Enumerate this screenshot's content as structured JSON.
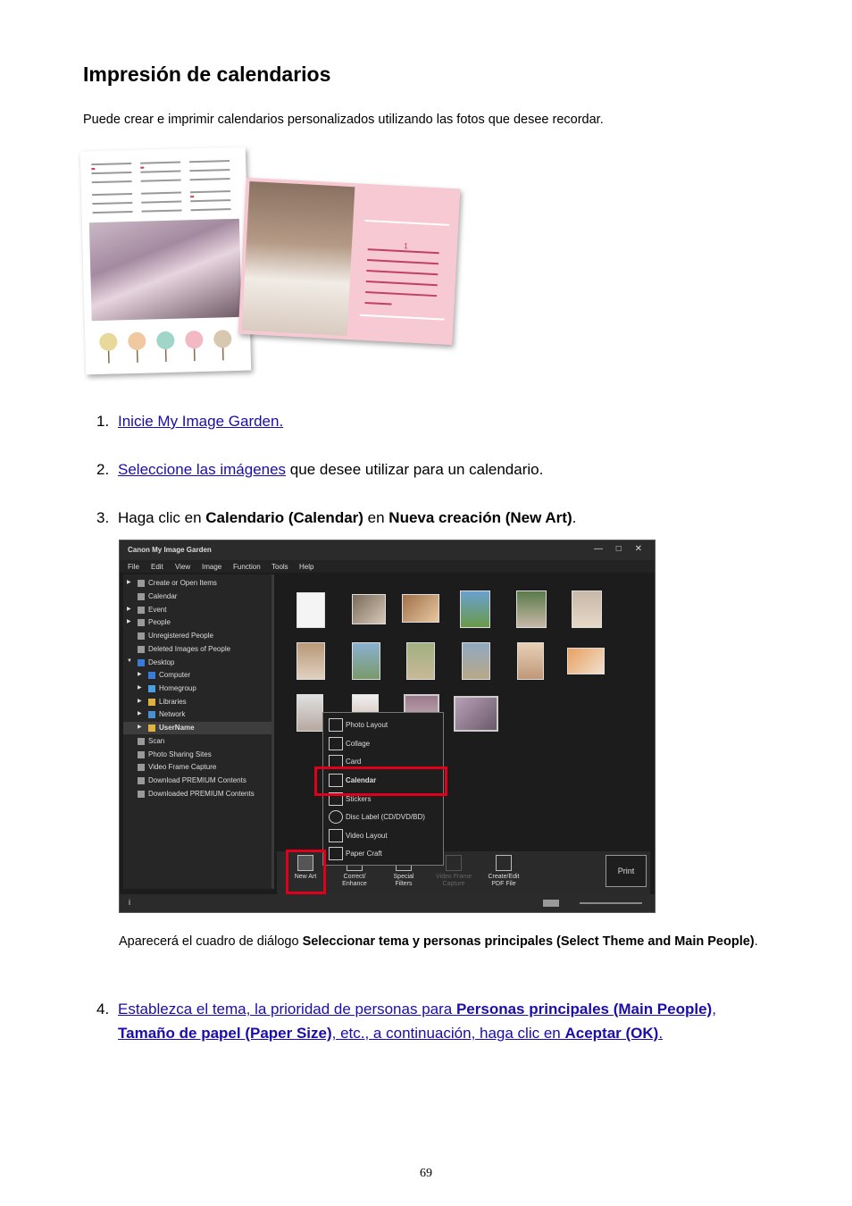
{
  "title": "Impresión de calendarios",
  "intro": "Puede crear e imprimir calendarios personalizados utilizando las fotos que desee recordar.",
  "steps": [
    {
      "num": "1.",
      "link": "Inicie My Image Garden."
    },
    {
      "num": "2.",
      "link": "Seleccione las imágenes",
      "rest": " que desee utilizar para un calendario."
    },
    {
      "num": "3.",
      "a": "Haga clic en ",
      "b1": "Calendario (Calendar)",
      "c": " en ",
      "b2": "Nueva creación (New Art)",
      "d": "."
    },
    {
      "num": "4.",
      "p1": "Establezca el tema, la prioridad de personas para ",
      "b1": "Personas principales (Main People)",
      "p2": ", ",
      "b2": "Tamaño de papel (Paper Size)",
      "p3": ", etc., a continuación, haga clic en ",
      "b3": "Aceptar (OK)",
      "p4": "."
    }
  ],
  "note": {
    "a": "Aparecerá el cuadro de diálogo ",
    "b": "Seleccionar tema y personas principales (Select Theme and Main People)",
    "c": "."
  },
  "page_number": "69",
  "calendar_month": "1",
  "app": {
    "title": "Canon My Image Garden",
    "window_controls": "— □ ✕",
    "menu": [
      "File",
      "Edit",
      "View",
      "Image",
      "Function",
      "Tools",
      "Help"
    ],
    "sidebar": [
      "Create or Open Items",
      "Calendar",
      "Event",
      "People",
      "Unregistered People",
      "Deleted Images of People",
      "Desktop",
      "Computer",
      "Homegroup",
      "Libraries",
      "Network",
      "UserName",
      "Scan",
      "Photo Sharing Sites",
      "Video Frame Capture",
      "Download PREMIUM Contents",
      "Downloaded PREMIUM Contents"
    ],
    "new_art_menu": [
      "Photo Layout",
      "Collage",
      "Card",
      "Calendar",
      "Stickers",
      "Disc Label (CD/DVD/BD)",
      "Video Layout",
      "Paper Craft"
    ],
    "bottom": [
      "New Art",
      "Correct/ Enhance",
      "Special Filters",
      "Video Frame Capture",
      "Create/Edit PDF File"
    ],
    "print": "Print",
    "info": "i"
  },
  "colors": {
    "link": "#1a0dab",
    "highlight": "#e0001b"
  }
}
